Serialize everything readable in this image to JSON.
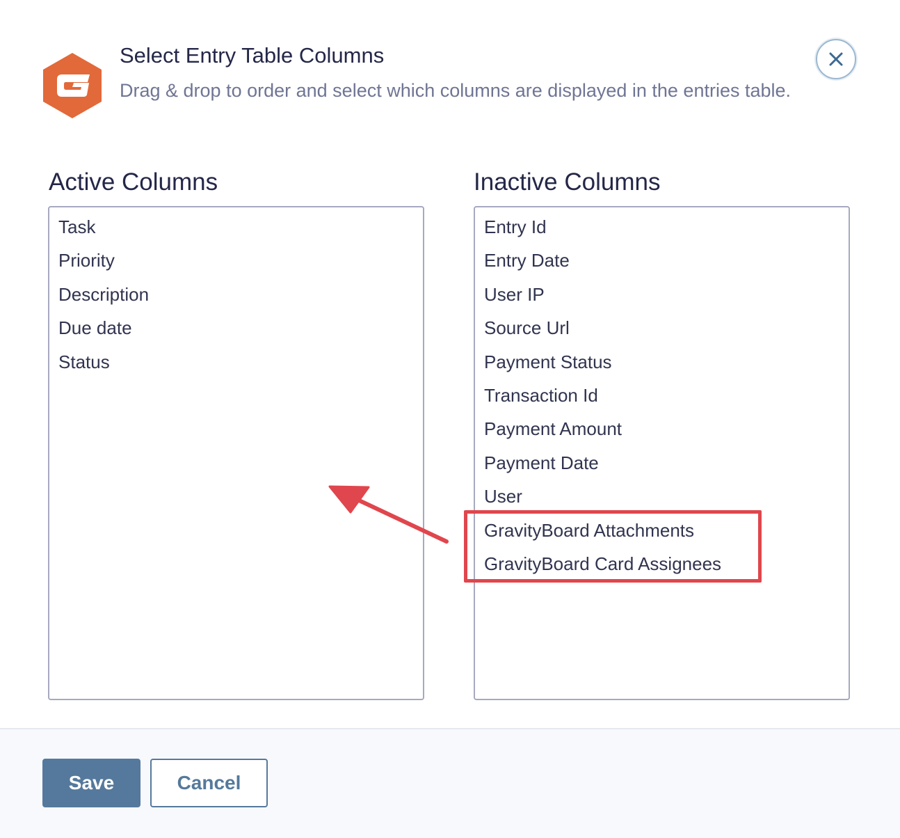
{
  "header": {
    "logo_icon": "gravity-forms-logo-icon",
    "title": "Select Entry Table Columns",
    "subtitle": "Drag & drop to order and select which columns are displayed in the entries table.",
    "close_icon": "close-icon"
  },
  "active_columns": {
    "heading": "Active Columns",
    "items": [
      "Task",
      "Priority",
      "Description",
      "Due date",
      "Status"
    ]
  },
  "inactive_columns": {
    "heading": "Inactive Columns",
    "items": [
      "Entry Id",
      "Entry Date",
      "User IP",
      "Source Url",
      "Payment Status",
      "Transaction Id",
      "Payment Amount",
      "Payment Date",
      "User",
      "GravityBoard Attachments",
      "GravityBoard Card Assignees"
    ]
  },
  "footer": {
    "save_label": "Save",
    "cancel_label": "Cancel"
  },
  "colors": {
    "logo": "#e2693a",
    "annotation": "#e0464d",
    "primary": "#55799c",
    "title": "#242748",
    "subtitle": "#6f7594"
  }
}
